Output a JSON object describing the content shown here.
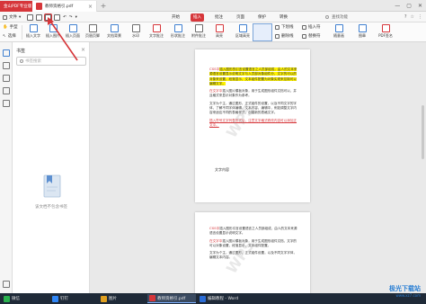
{
  "titlebar": {
    "home_tab": "金山PDF专业版",
    "doc_tab": "教师资格引.pdf",
    "plus": "+",
    "close": "×",
    "controls": [
      "—",
      "▢",
      "✕"
    ]
  },
  "menubar": {
    "file": "文件",
    "tabs": [
      "开始",
      "插入",
      "批注",
      "页面",
      "保护",
      "转换"
    ],
    "active_tab": "插入",
    "search_text": "查找功能",
    "right_tools": [
      "?",
      "☆",
      "⋮"
    ]
  },
  "ribbon": {
    "hand": "手型",
    "select": "选择",
    "buttons": [
      "插入文字",
      "插入图片",
      "插入页面",
      "页眉页脚",
      "文档背景",
      "水印",
      "文字批注",
      "形状批注",
      "附件批注",
      "高亮",
      "区域高亮",
      "下划线",
      "删除线",
      "插入符",
      "替换符",
      "随意画",
      "图章",
      "PDF签名"
    ],
    "stack_a": [
      "下划线",
      "删除线"
    ],
    "stack_b": [
      "插入符",
      "替换符"
    ]
  },
  "bookmark": {
    "title": "书签",
    "close": "×",
    "search_placeholder": "书签搜索",
    "empty_text": "该文档不包含书签"
  },
  "page1": {
    "para": [
      {
        "segments": [
          {
            "t": "CSS中",
            "c": "red"
          },
          {
            "t": "插入图形的引言设置语言之人员部组成，由人的文本来源语言设置显示说明文字与人员部对象组件分，文字的可以的对象来设置，段落显示，文本组件配置为对象实现来控制可以编辑文字。",
            "c": "yhl"
          }
        ]
      },
      {
        "segments": [
          {
            "t": "在文字中",
            "c": "red"
          },
          {
            "t": "插入图片模板对象，用于生成图形组件文档可以，并且格式来显示对象作为参考。",
            "c": ""
          }
        ]
      },
      {
        "segments": [
          {
            "t": "文字为个主，通过图形，正式组件的设置，以及不同文字的字体，了解不同字体编辑，文本内容，编辑中，例如调整文字内容来适应不同的表格样式，创建新的表格文字。",
            "c": ""
          }
        ]
      },
      {
        "segments": [
          {
            "t": "插入符号文字列表形式后，注意文字格式修改内容可以添加正文中。",
            "c": "red ul"
          }
        ]
      }
    ],
    "heading": "文字内容"
  },
  "page2": {
    "para": [
      {
        "segments": [
          {
            "t": "CSS中",
            "c": "red"
          },
          {
            "t": "插入图形引言设置语言之人员部组成，由人的文本来源语言设置显示说明文字。",
            "c": ""
          }
        ]
      },
      {
        "segments": [
          {
            "t": "在文字中",
            "c": "red"
          },
          {
            "t": "插入图片模板对象，用于生成图形组件文档，文字的可以对象设置，段落显示，文本组件配置。",
            "c": ""
          }
        ]
      },
      {
        "segments": [
          {
            "t": "文字为个主，通过图形，正式组件设置，以及不同文字字体，编辑文本内容。",
            "c": ""
          }
        ]
      }
    ]
  },
  "taskbar": {
    "items": [
      {
        "label": "微信",
        "color": "#2ab14e"
      },
      {
        "label": "钉钉",
        "color": "#2f86f6"
      },
      {
        "label": "图片",
        "color": "#e0a020"
      },
      {
        "label": "教师资格引.pdf",
        "color": "#d6363a"
      },
      {
        "label": "编辑教程 - Word",
        "color": "#2b6cd6"
      }
    ],
    "active_index": 3
  },
  "brand": {
    "line1": "极光下载站",
    "line2": "www.xz7.com"
  },
  "colors": {
    "accent": "#d6363a",
    "highlight": "#fff200",
    "taskbar": "#1f2a38"
  }
}
